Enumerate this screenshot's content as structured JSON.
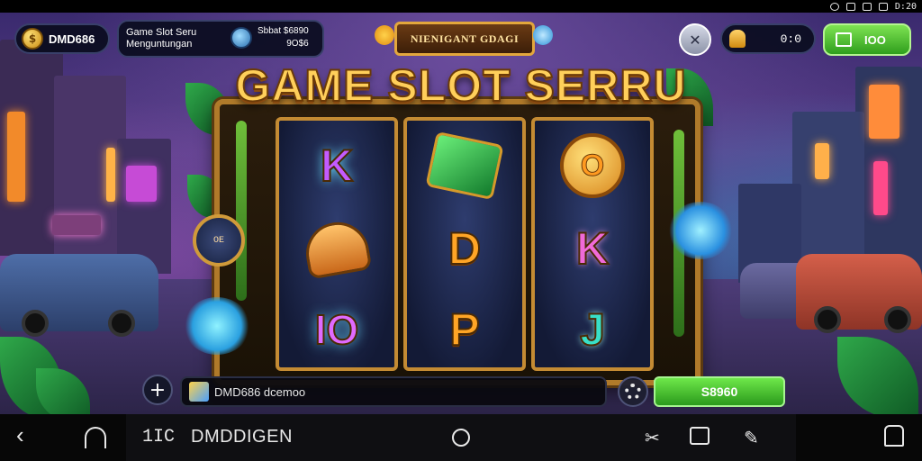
{
  "status_bar": {
    "time": "D:20",
    "icons": [
      "alarm-icon",
      "signal-icon",
      "battery-icon",
      "wifi-icon"
    ]
  },
  "hud": {
    "brand": {
      "label": "DMD686",
      "icon": "gold-coin-icon"
    },
    "info": {
      "line1": "Game Slot Seru",
      "line2": "Menguntungan",
      "stat1": "Sbbat $6890",
      "stat2": "9O$6"
    },
    "banner": "NIENIGANT GDAGI",
    "tools_icon": "tools-icon",
    "balance": {
      "value": "0:0",
      "icon": "bell-icon"
    },
    "action_button": {
      "label": "IOO",
      "icon": "cash-icon"
    }
  },
  "title": "GAME SLOT SERRU",
  "reels": [
    [
      {
        "kind": "text",
        "text": "K",
        "style": "purple"
      },
      {
        "kind": "shape",
        "name": "golden-bell-symbol"
      },
      {
        "kind": "text",
        "text": "IO",
        "style": "ten"
      }
    ],
    [
      {
        "kind": "shape",
        "name": "emerald-gem-symbol"
      },
      {
        "kind": "text",
        "text": "D",
        "style": "gold"
      },
      {
        "kind": "text",
        "text": "P",
        "style": "gold"
      }
    ],
    [
      {
        "kind": "coin",
        "text": "O"
      },
      {
        "kind": "text",
        "text": "K",
        "style": "pink"
      },
      {
        "kind": "text",
        "text": "J",
        "style": "teal"
      }
    ]
  ],
  "clock_label": "OE",
  "controls": {
    "plus": "+",
    "input_text": "DMD686 dcemoo",
    "spin_label": "S8960",
    "gear_icon": "gear-icon"
  },
  "nav": {
    "number": "1IC",
    "title": "DMDDIGEN"
  },
  "colors": {
    "accent_green": "#4ccf2e",
    "gold": "#ffcf5a",
    "frame": "#b07a2a"
  }
}
